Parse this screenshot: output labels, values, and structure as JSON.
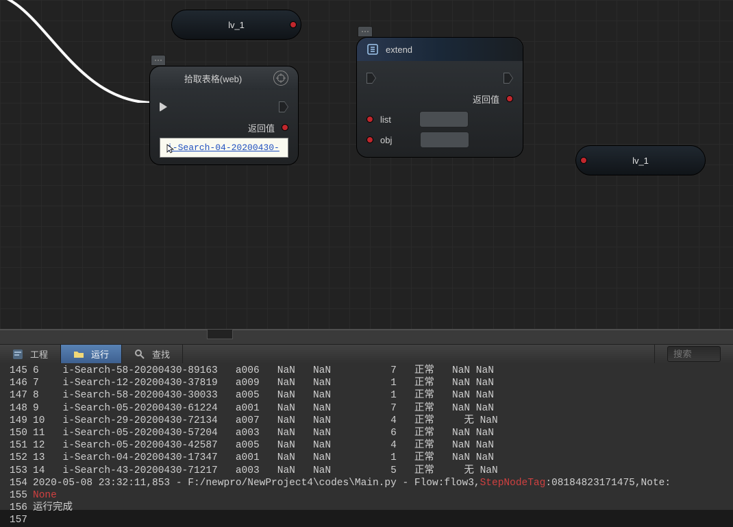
{
  "nodes": {
    "lv1_top": {
      "label": "lv_1"
    },
    "lv1_bottom": {
      "label": "lv_1"
    },
    "pickTable": {
      "title": "拾取表格(web)",
      "return": "返回值",
      "thumb_text": "i-Search-04-20200430-"
    },
    "extend": {
      "title": "extend",
      "return": "返回值",
      "param_list": "list",
      "param_obj": "obj"
    }
  },
  "tabs": {
    "project": "工程",
    "run": "运行",
    "find": "查找",
    "search_placeholder": "搜索"
  },
  "console": {
    "rows": [
      {
        "n": "145",
        "idx": "6 ",
        "name": "i-Search-58-20200430-89163",
        "c3": "a006",
        "c4": "NaN",
        "c5": "NaN",
        "c6": "7",
        "c7": "正常",
        "c8": "NaN",
        "c9": "NaN"
      },
      {
        "n": "146",
        "idx": "7 ",
        "name": "i-Search-12-20200430-37819",
        "c3": "a009",
        "c4": "NaN",
        "c5": "NaN",
        "c6": "1",
        "c7": "正常",
        "c8": "NaN",
        "c9": "NaN"
      },
      {
        "n": "147",
        "idx": "8 ",
        "name": "i-Search-58-20200430-30033",
        "c3": "a005",
        "c4": "NaN",
        "c5": "NaN",
        "c6": "1",
        "c7": "正常",
        "c8": "NaN",
        "c9": "NaN"
      },
      {
        "n": "148",
        "idx": "9 ",
        "name": "i-Search-05-20200430-61224",
        "c3": "a001",
        "c4": "NaN",
        "c5": "NaN",
        "c6": "7",
        "c7": "正常",
        "c8": "NaN",
        "c9": "NaN"
      },
      {
        "n": "149",
        "idx": "10",
        "name": "i-Search-29-20200430-72134",
        "c3": "a007",
        "c4": "NaN",
        "c5": "NaN",
        "c6": "4",
        "c7": "正常",
        "c8": "  无",
        "c9": "NaN"
      },
      {
        "n": "150",
        "idx": "11",
        "name": "i-Search-05-20200430-57204",
        "c3": "a003",
        "c4": "NaN",
        "c5": "NaN",
        "c6": "6",
        "c7": "正常",
        "c8": "NaN",
        "c9": "NaN"
      },
      {
        "n": "151",
        "idx": "12",
        "name": "i-Search-05-20200430-42587",
        "c3": "a005",
        "c4": "NaN",
        "c5": "NaN",
        "c6": "4",
        "c7": "正常",
        "c8": "NaN",
        "c9": "NaN"
      },
      {
        "n": "152",
        "idx": "13",
        "name": "i-Search-04-20200430-17347",
        "c3": "a001",
        "c4": "NaN",
        "c5": "NaN",
        "c6": "1",
        "c7": "正常",
        "c8": "NaN",
        "c9": "NaN"
      },
      {
        "n": "153",
        "idx": "14",
        "name": "i-Search-43-20200430-71217",
        "c3": "a003",
        "c4": "NaN",
        "c5": "NaN",
        "c6": "5",
        "c7": "正常",
        "c8": "  无",
        "c9": "NaN"
      }
    ],
    "log_a_n": "154",
    "log_a_pre": "2020-05-08 23:32:11,853 - F:/newpro/NewProject4\\codes\\Main.py - Flow:flow3,",
    "log_a_key": "StepNodeTag",
    "log_a_post": ":08184823171475,Note:",
    "log_b_n": "155",
    "log_b_txt": "None",
    "log_c_n": "156",
    "log_c_txt": "运行完成",
    "log_d_n": "157"
  }
}
